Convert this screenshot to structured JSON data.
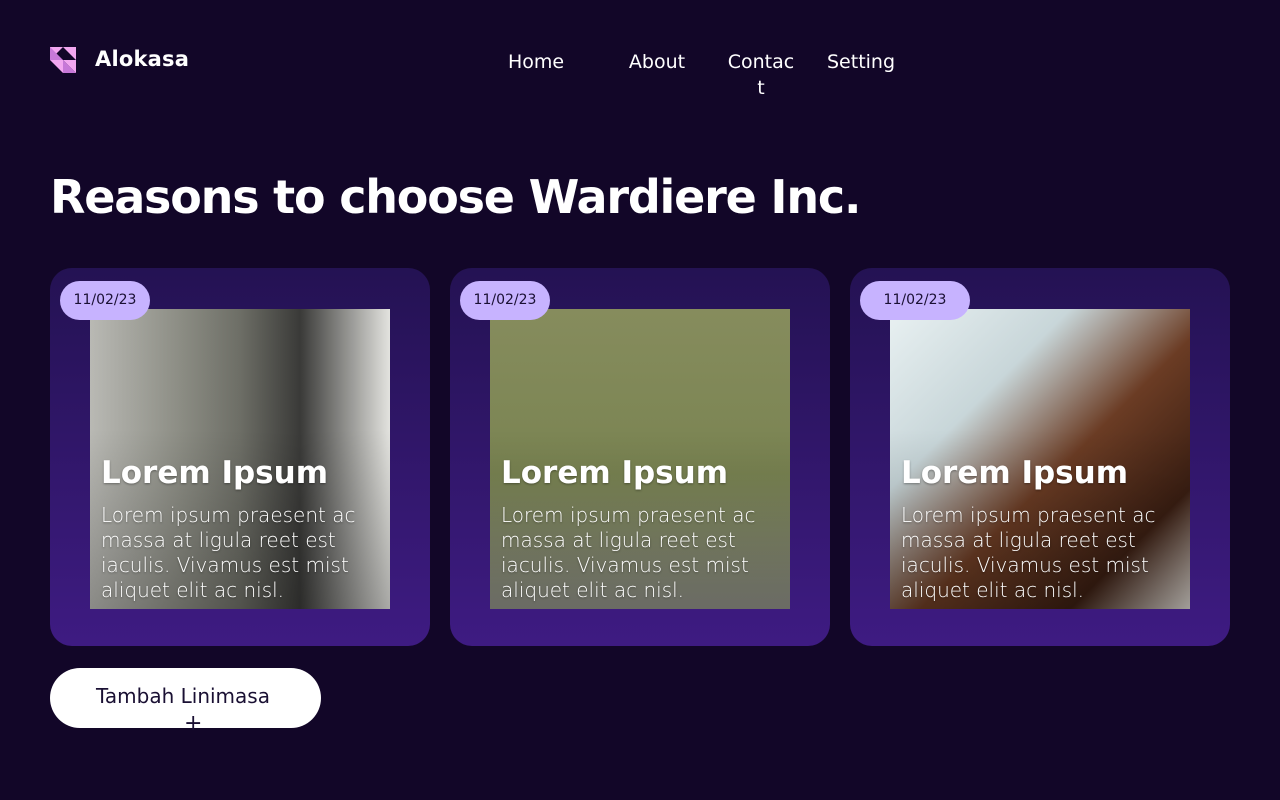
{
  "header": {
    "brand": "Alokasa",
    "nav": {
      "home": "Home",
      "about": "About",
      "contact": "Contact",
      "setting": "Setting"
    }
  },
  "main": {
    "heading": "Reasons to choose Wardiere Inc."
  },
  "cards": [
    {
      "date": "11/02/23",
      "title": "Lorem Ipsum",
      "text": "Lorem ipsum praesent ac massa at ligula reet est iaculis. Vivamus est mist aliquet elit ac nisl."
    },
    {
      "date": "11/02/23",
      "title": "Lorem Ipsum",
      "text": "Lorem ipsum praesent ac massa at ligula reet est iaculis. Vivamus est mist aliquet elit ac nisl."
    },
    {
      "date": "11/02/23",
      "title": "Lorem Ipsum",
      "text": "Lorem ipsum praesent ac massa at ligula reet est iaculis. Vivamus est mist aliquet elit ac nisl."
    }
  ],
  "actions": {
    "add_label": "Tambah Linimasa",
    "add_icon": "+"
  },
  "colors": {
    "background": "#120628",
    "card_gradient_top": "#241253",
    "card_gradient_bottom": "#3e1b82",
    "date_pill": "#c7b3ff",
    "logo": "#f2a6f0"
  },
  "icons": {
    "logo": "alokasa-logo-icon"
  }
}
